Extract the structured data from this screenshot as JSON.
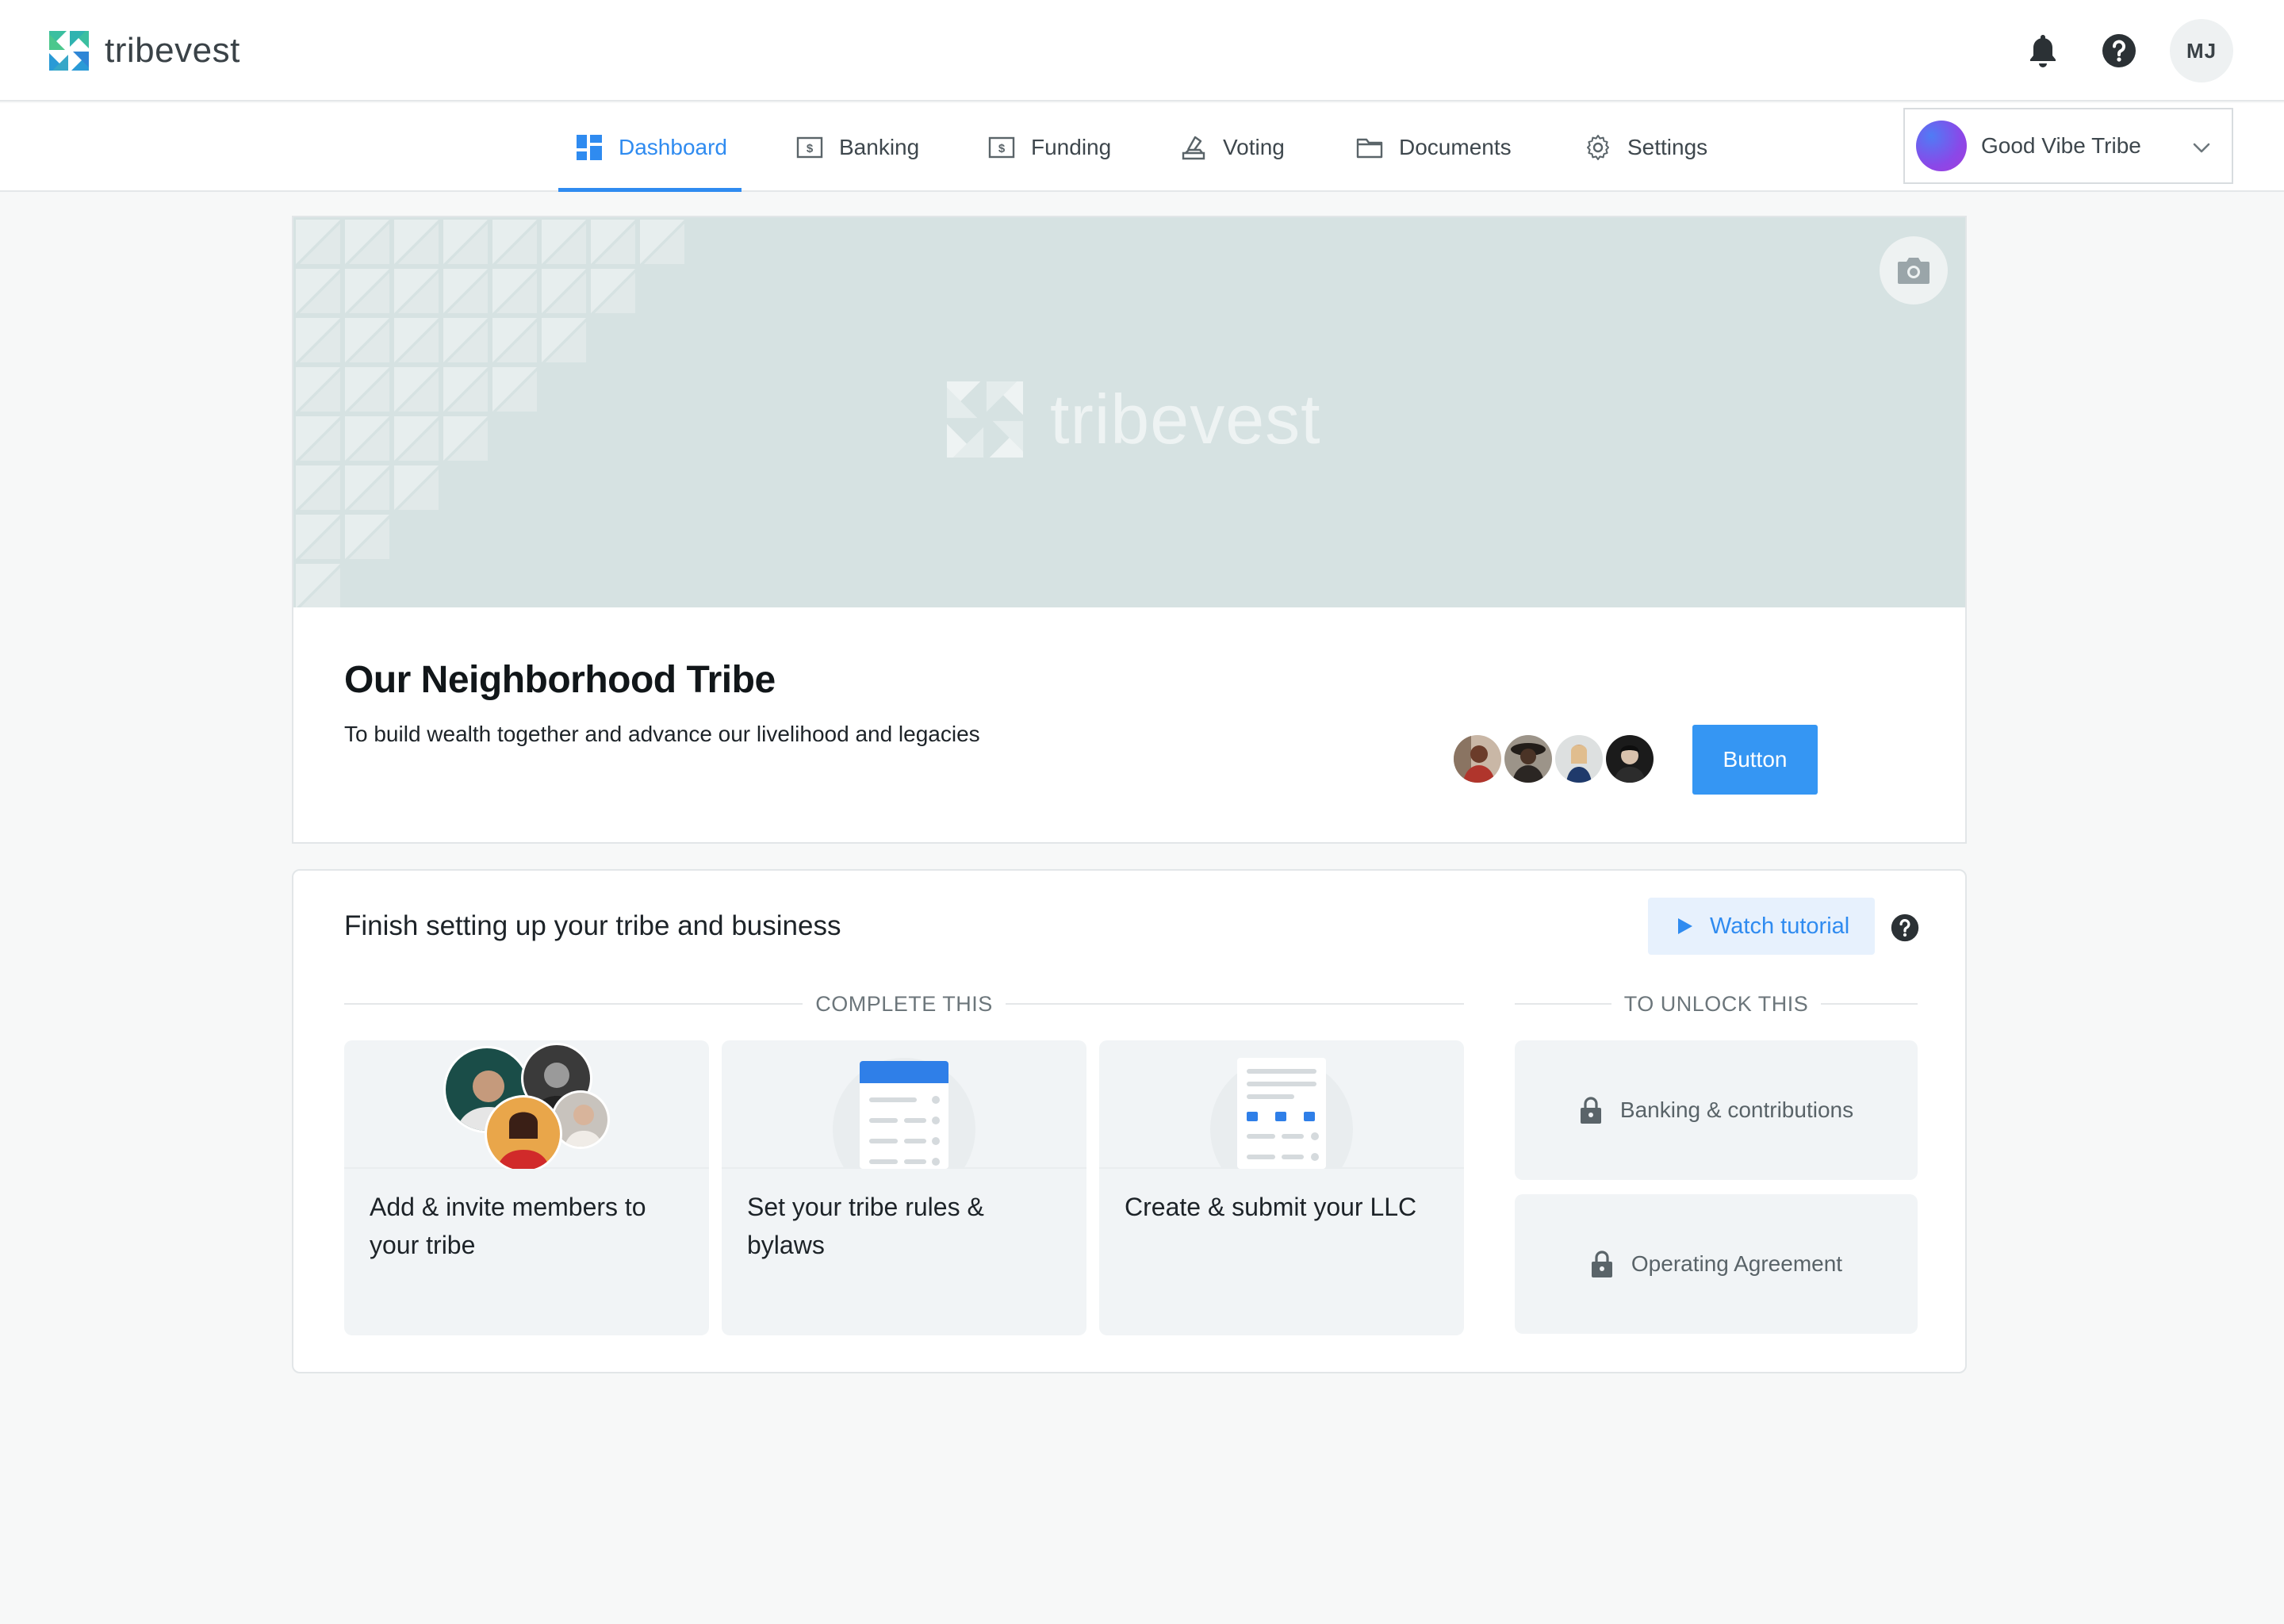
{
  "brand": {
    "name": "tribevest",
    "accent": "#2f8bf0"
  },
  "header": {
    "notifications_icon": "bell-icon",
    "help_icon": "help-circle-icon",
    "user_initials": "MJ"
  },
  "nav": {
    "tabs": [
      {
        "label": "Dashboard",
        "icon": "dashboard-icon",
        "active": true
      },
      {
        "label": "Banking",
        "icon": "dollar-box-icon",
        "active": false
      },
      {
        "label": "Funding",
        "icon": "dollar-box-icon",
        "active": false
      },
      {
        "label": "Voting",
        "icon": "ballot-icon",
        "active": false
      },
      {
        "label": "Documents",
        "icon": "folder-icon",
        "active": false
      },
      {
        "label": "Settings",
        "icon": "gear-icon",
        "active": false
      }
    ],
    "tribe_selector": {
      "selected": "Good Vibe Tribe"
    }
  },
  "hero": {
    "banner_brand": "tribevest",
    "title": "Our Neighborhood Tribe",
    "mission": "To build wealth together and advance our livelihood and legacies",
    "button_label": "Button",
    "member_count_shown": 4
  },
  "setup": {
    "title": "Finish setting up your tribe and business",
    "watch_label": "Watch tutorial",
    "complete_label": "COMPLETE THIS",
    "unlock_label": "TO UNLOCK THIS",
    "tasks": [
      {
        "label": "Add & invite members to your tribe"
      },
      {
        "label": "Set your tribe rules & bylaws"
      },
      {
        "label": "Create & submit your LLC"
      }
    ],
    "locked": [
      {
        "label": "Banking & contributions"
      },
      {
        "label": "Operating Agreement"
      }
    ]
  }
}
